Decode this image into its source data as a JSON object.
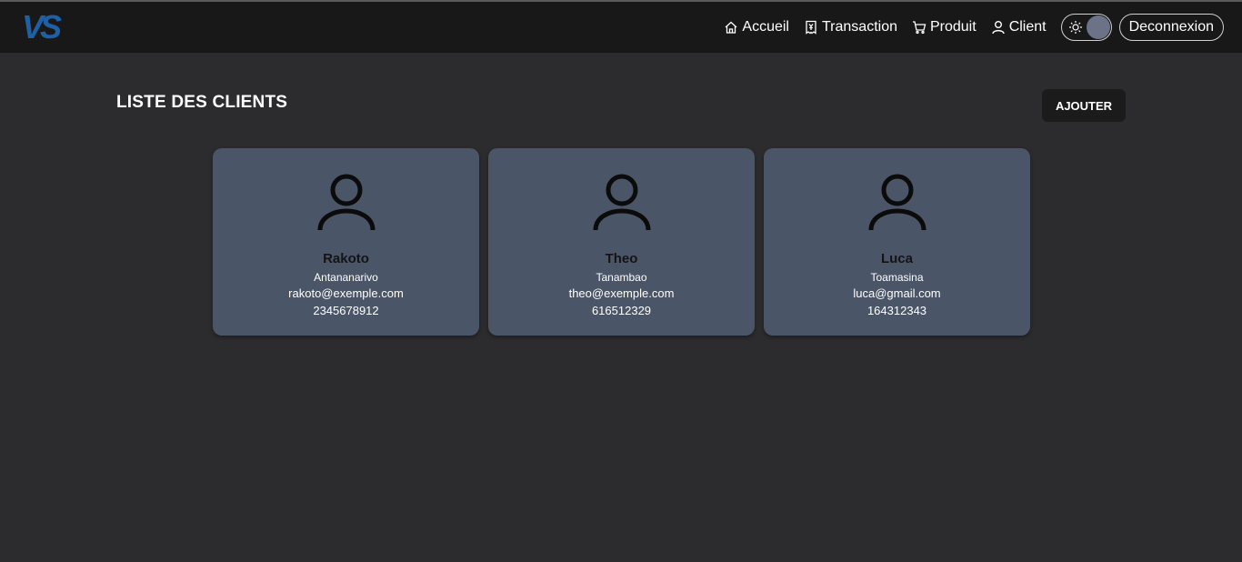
{
  "app": {
    "logo_text": "VS",
    "brand_color": "#1f5fa4"
  },
  "nav": {
    "items": [
      {
        "label": "Accueil",
        "icon": "home-icon"
      },
      {
        "label": "Transaction",
        "icon": "receipt-icon"
      },
      {
        "label": "Produit",
        "icon": "cart-icon"
      },
      {
        "label": "Client",
        "icon": "user-icon"
      }
    ],
    "theme_toggle_icon": "sun-icon",
    "logout_label": "Deconnexion"
  },
  "main": {
    "title": "LISTE DES CLIENTS",
    "add_label": "AJOUTER",
    "clients": [
      {
        "name": "Rakoto",
        "city": "Antananarivo",
        "email": "rakoto@exemple.com",
        "phone": "2345678912"
      },
      {
        "name": "Theo",
        "city": "Tanambao",
        "email": "theo@exemple.com",
        "phone": "616512329"
      },
      {
        "name": "Luca",
        "city": "Toamasina",
        "email": "luca@gmail.com",
        "phone": "164312343"
      }
    ]
  },
  "colors": {
    "background": "#2c2c2f",
    "navbar": "#181818",
    "card": "#4a5567"
  }
}
